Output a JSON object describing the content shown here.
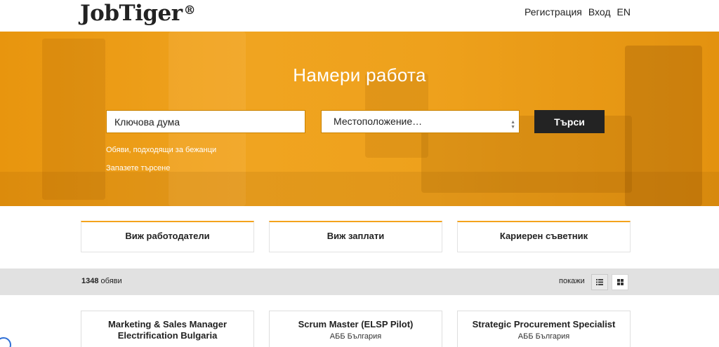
{
  "header": {
    "logo_text": "JobTiger",
    "logo_mark": "®",
    "nav": {
      "register": "Регистрация",
      "login": "Вход",
      "language": "EN"
    }
  },
  "hero": {
    "title": "Намери работа",
    "keyword_placeholder": "Ключова дума",
    "location_value": "Местоположение…",
    "search_label": "Търси",
    "refugee_link": "Обяви, подходящи за бежанци",
    "save_search_link": "Запазете търсене",
    "accent_color": "#f0a420"
  },
  "quick_links": [
    {
      "label": "Виж работодатели"
    },
    {
      "label": "Виж заплати"
    },
    {
      "label": "Кариерен съветник"
    }
  ],
  "results": {
    "count": "1348",
    "count_suffix": "обяви",
    "show_label": "покажи",
    "view_list_icon": "list-view-icon",
    "view_grid_icon": "grid-view-icon"
  },
  "jobs": [
    {
      "title_line1": "Marketing & Sales Manager",
      "title_line2": "Electrification Bulgaria",
      "company": ""
    },
    {
      "title_line1": "Scrum Master (ELSP Pilot)",
      "title_line2": "",
      "company": "АББ България"
    },
    {
      "title_line1": "Strategic Procurement Specialist",
      "title_line2": "",
      "company": "АББ България"
    }
  ]
}
